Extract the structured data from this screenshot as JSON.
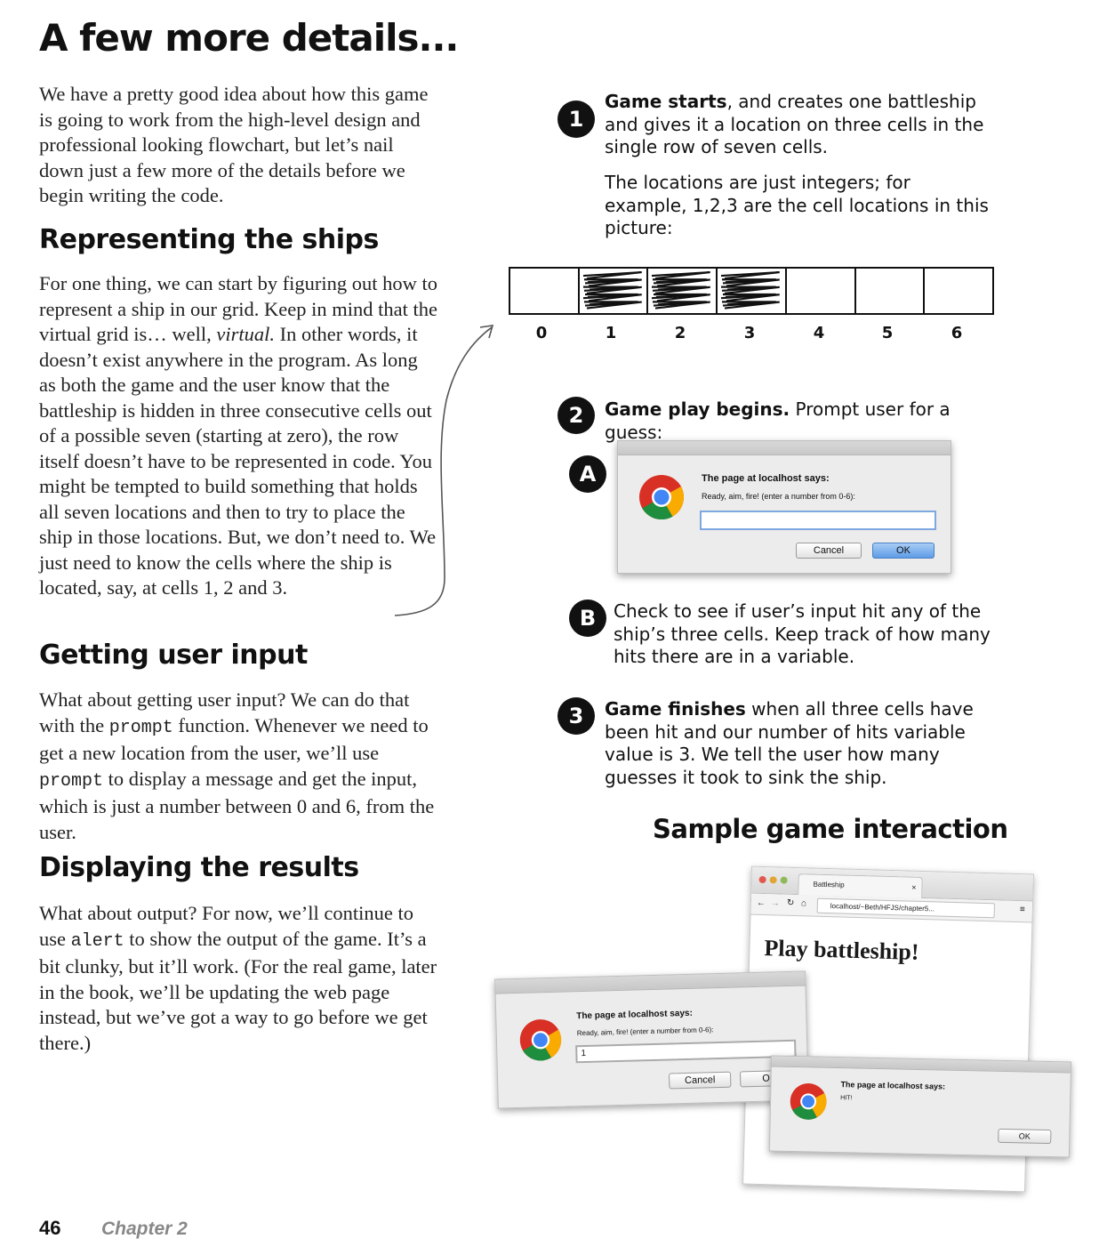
{
  "title": "A few more details...",
  "intro": "We have a pretty good idea about how this game is going to work from the high-level design and professional looking flowchart, but let’s nail down just a few more of the details before we begin writing the code.",
  "sections": {
    "ships": {
      "heading": "Representing the ships",
      "text_1": "For one thing, we can start by figuring out how to represent a ship in our grid.  Keep in mind that the virtual grid is… well, ",
      "emph": "virtual.",
      "text_2": " In other words, it doesn’t exist anywhere in the program. As long as both the game and the user know that the battleship is hidden in three consecutive cells out of a possible seven (starting at zero), the row itself doesn’t have to be represented in code. You might be tempted to build something that holds all seven locations and then to try to place the ship in those locations. But, we don’t need to. We just need to know the cells where the ship is located, say, at cells 1, 2 and 3."
    },
    "input": {
      "heading": "Getting user input",
      "text_1": "What about getting user input? We can do that with the ",
      "code_1": "prompt",
      "text_2": " function. Whenever we need to get a new location from the user, we’ll use ",
      "code_2": "prompt",
      "text_3": " to display a message and get the input, which is just a number between 0 and 6, from the user."
    },
    "results": {
      "heading": "Displaying the results",
      "text_1": "What about output? For now, we’ll continue to use ",
      "code_1": "alert",
      "text_2": " to show the output of the game. It’s a bit clunky, but it’ll work. (For the real game, later in the book, we’ll be updating the web page instead, but we’ve got a way to go before we get there.)"
    }
  },
  "steps": {
    "step1": {
      "badge": "1",
      "bold": "Game starts",
      "text": ", and creates one battleship and gives it a location on three cells in the single row of seven cells.",
      "note": "The locations are just integers; for example, 1,2,3 are the cell locations in this picture:"
    },
    "step2": {
      "badge": "2",
      "bold": "Game play begins.",
      "text": " Prompt user for a guess:"
    },
    "stepA": {
      "badge": "A"
    },
    "stepB": {
      "badge": "B",
      "text": "Check to see if user’s input hit any of the ship’s three cells. Keep track of how many hits there are in a variable."
    },
    "step3": {
      "badge": "3",
      "bold": "Game finishes",
      "text": " when all three cells have been  hit and our number of hits variable value is 3. We tell the user how many guesses it took to sink the ship."
    }
  },
  "grid": {
    "indices": [
      "0",
      "1",
      "2",
      "3",
      "4",
      "5",
      "6"
    ],
    "ship_cells": [
      1,
      2,
      3
    ]
  },
  "prompt_dialog": {
    "title": "The page at localhost says:",
    "message": "Ready, aim, fire! (enter a number from 0-6):",
    "input_value": "",
    "cancel": "Cancel",
    "ok": "OK"
  },
  "sample": {
    "heading": "Sample game interaction",
    "browser": {
      "tab_title": "Battleship",
      "url": "localhost/~Beth/HFJS/chapter5...",
      "page_heading": "Play battleship!"
    },
    "prompt": {
      "title": "The page at localhost says:",
      "message": "Ready, aim, fire! (enter a number from 0-6):",
      "input_value": "1",
      "cancel": "Cancel",
      "ok": "OK"
    },
    "alert": {
      "title": "The page at localhost says:",
      "message": "HIT!",
      "ok": "OK"
    }
  },
  "footer": {
    "page_number": "46",
    "chapter": "Chapter 2"
  }
}
